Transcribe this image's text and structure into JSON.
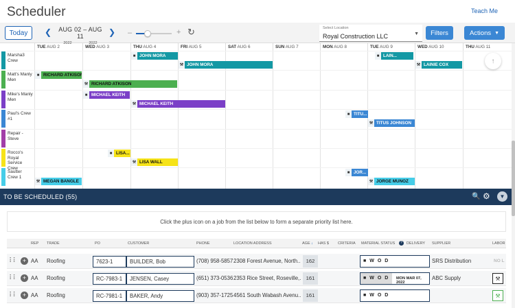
{
  "header": {
    "title": "Scheduler",
    "teach_me": "Teach Me"
  },
  "toolbar": {
    "today": "Today",
    "range": "AUG 02  –  AUG 11",
    "year_start": "2022",
    "year_end": "2022",
    "zoom_minus": "–",
    "zoom_plus": "+",
    "location_label": "Select Location",
    "location_value": "Royal Construction LLC",
    "filters": "Filters",
    "actions": "Actions"
  },
  "days": [
    {
      "dow": "TUE",
      "date": "AUG 2"
    },
    {
      "dow": "WED",
      "date": "AUG 3"
    },
    {
      "dow": "THU",
      "date": "AUG 4"
    },
    {
      "dow": "FRI",
      "date": "AUG 5"
    },
    {
      "dow": "SAT",
      "date": "AUG 6"
    },
    {
      "dow": "SUN",
      "date": "AUG 7"
    },
    {
      "dow": "MON",
      "date": "AUG 8"
    },
    {
      "dow": "TUE",
      "date": "AUG 9"
    },
    {
      "dow": "WED",
      "date": "AUG 10"
    },
    {
      "dow": "THU",
      "date": "AUG 11"
    }
  ],
  "crews": [
    {
      "name": "Marsha3 Crew",
      "color": "#1398a4"
    },
    {
      "name": "Matt's Manly Men",
      "color": "#4caf50"
    },
    {
      "name": "Mike's Manly Men",
      "color": "#7b3fc7"
    },
    {
      "name": "Paul's Crew #1",
      "color": "#3b87d4"
    },
    {
      "name": "Repair - Steve",
      "color": "#a23ea8"
    },
    {
      "name": "Rocco's Royal Service Crew",
      "color": "#f6e318"
    },
    {
      "name": "Sautter Crew 1",
      "color": "#46cde8"
    }
  ],
  "jobs": [
    {
      "name": "JOHN MORA",
      "icon": "truck-icon"
    },
    {
      "name": "JOHN MORA",
      "icon": "hammer-icon"
    },
    {
      "name": "LAIN...",
      "icon": "truck-icon"
    },
    {
      "name": "LAINIE COX",
      "icon": "hammer-icon"
    },
    {
      "name": "RICHARD ATKISON",
      "icon": "truck-icon"
    },
    {
      "name": "RICHARD ATKISON",
      "icon": "hammer-icon"
    },
    {
      "name": "MICHAEL KEITH",
      "icon": "truck-icon"
    },
    {
      "name": "MICHAEL KEITH",
      "icon": "hammer-icon"
    },
    {
      "name": "TITU...",
      "icon": "truck-icon"
    },
    {
      "name": "TITUS JOHNSON",
      "icon": "hammer-icon"
    },
    {
      "name": "LISA...",
      "icon": "truck-icon"
    },
    {
      "name": "LISA WALL",
      "icon": "hammer-icon"
    },
    {
      "name": "JOR...",
      "icon": "truck-icon"
    },
    {
      "name": "MEGAN BANGLE",
      "icon": "hammer-icon"
    },
    {
      "name": "JORGE MUNOZ",
      "icon": "hammer-icon"
    }
  ],
  "to_be_scheduled": {
    "title": "TO BE SCHEDULED (55)",
    "hint": "Click the plus icon on a job from the list below to form a separate priority list here."
  },
  "table": {
    "headers": [
      "REP",
      "TRADE",
      "PO",
      "CUSTOMER",
      "PHONE",
      "LOCATION ADDRESS",
      "AGE",
      "HAS $",
      "CRITERIA",
      "MATERIAL STATUS",
      "DELIVERY",
      "SUPPLIER",
      "LABOR"
    ],
    "rows": [
      {
        "rep": "AA",
        "trade": "Roofing",
        "po": "7623-1",
        "customer": "BUILDER, Bob",
        "phone": "(708) 958-5857",
        "address": "2308 Forest Avenue, North...",
        "age": "162",
        "delivery": "",
        "supplier": "SRS Distribution",
        "labor": "NO L"
      },
      {
        "rep": "AA",
        "trade": "Roofing",
        "po": "RC-7983-1",
        "customer": "JENSEN, Casey",
        "phone": "(651) 373-0536",
        "address": "2353 Rice Street, Roseville,...",
        "age": "161",
        "delivery": "MON MAR 07, 2022",
        "supplier": "ABC Supply",
        "labor": ""
      },
      {
        "rep": "AA",
        "trade": "Roofing",
        "po": "RC-7981-1",
        "customer": "BAKER, Andy",
        "phone": "(903) 357-1725",
        "address": "4561 South Wabash Avenu...",
        "age": "161",
        "delivery": "",
        "supplier": "",
        "labor": ""
      }
    ],
    "material_letters": [
      "W",
      "O",
      "D"
    ]
  }
}
